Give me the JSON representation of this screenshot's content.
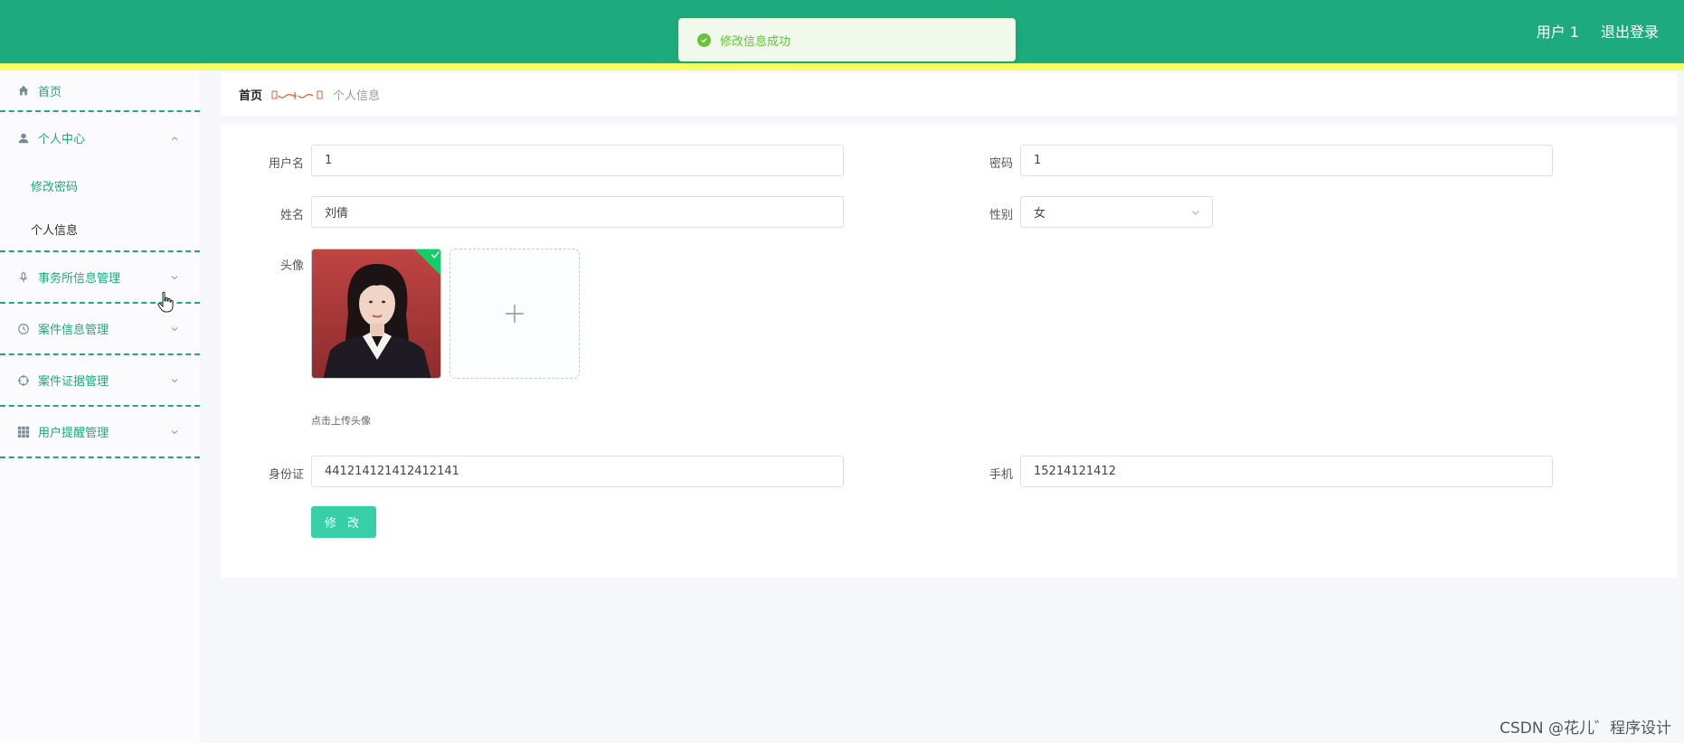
{
  "header": {
    "user_label": "用户 1",
    "logout_label": "退出登录",
    "bg_color": "#1daa7c",
    "stripe_color": "#f5ff66"
  },
  "toast": {
    "message": "修改信息成功",
    "icon": "check-circle-icon"
  },
  "sidebar": {
    "home": {
      "label": "首页",
      "icon": "home-icon"
    },
    "personal_center": {
      "label": "个人中心",
      "icon": "user-icon",
      "expanded": true,
      "children": [
        {
          "label": "修改密码",
          "active": false
        },
        {
          "label": "个人信息",
          "active": true
        }
      ]
    },
    "groups": [
      {
        "label": "事务所信息管理",
        "icon": "microphone-icon"
      },
      {
        "label": "案件信息管理",
        "icon": "clock-icon"
      },
      {
        "label": "案件证据管理",
        "icon": "crosshair-icon"
      },
      {
        "label": "用户提醒管理",
        "icon": "grid-icon"
      }
    ]
  },
  "breadcrumb": {
    "home": "首页",
    "current": "个人信息"
  },
  "form": {
    "username": {
      "label": "用户名",
      "value": "1"
    },
    "password": {
      "label": "密码",
      "value": "1"
    },
    "name": {
      "label": "姓名",
      "value": "刘倩"
    },
    "gender": {
      "label": "性别",
      "value": "女"
    },
    "avatar": {
      "label": "头像",
      "hint": "点击上传头像"
    },
    "id_card": {
      "label": "身份证",
      "value": "441214121412412141"
    },
    "phone": {
      "label": "手机",
      "value": "15214121412"
    },
    "submit_label": "修 改"
  },
  "watermark": "CSDN @花儿゛程序设计"
}
